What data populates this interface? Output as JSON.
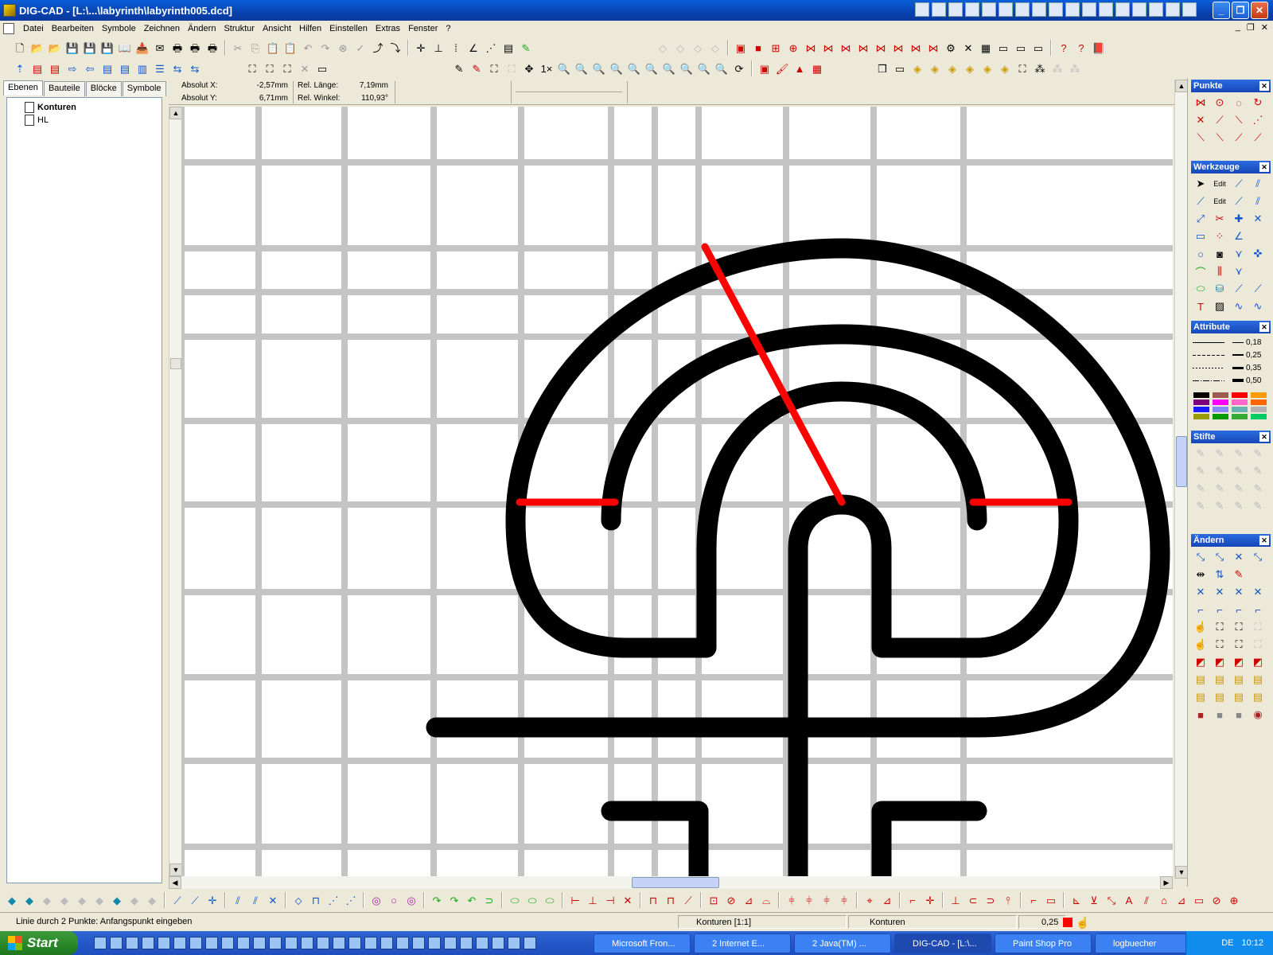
{
  "window": {
    "title": "DIG-CAD - [L:\\...\\labyrinth\\labyrinth005.dcd]"
  },
  "menu": {
    "items": [
      "Datei",
      "Bearbeiten",
      "Symbole",
      "Zeichnen",
      "Ändern",
      "Struktur",
      "Ansicht",
      "Hilfen",
      "Einstellen",
      "Extras",
      "Fenster",
      "?"
    ]
  },
  "left_panel": {
    "tabs": [
      "Ebenen",
      "Bauteile",
      "Blöcke",
      "Symbole"
    ],
    "active_tab": "Ebenen",
    "layers": [
      {
        "name": "Konturen",
        "active": true
      },
      {
        "name": "HL",
        "active": false
      }
    ]
  },
  "coords": {
    "abs_x_label": "Absolut X:",
    "abs_x_value": "-2,57mm",
    "abs_y_label": "Absolut Y:",
    "abs_y_value": "6,71mm",
    "rel_len_label": "Rel. Länge:",
    "rel_len_value": "7,19mm",
    "rel_angle_label": "Rel. Winkel:",
    "rel_angle_value": "110,93°"
  },
  "palettes": {
    "punkte": "Punkte",
    "werkzeuge": "Werkzeuge",
    "attribute": "Attribute",
    "stifte": "Stifte",
    "aendern": "Ändern",
    "line_weights": [
      "0,18",
      "0,25",
      "0,35",
      "0,50"
    ],
    "swatch_colors": [
      "#000000",
      "#9c5a50",
      "#ff0000",
      "#ff9900",
      "#7f007f",
      "#ff00ff",
      "#ff66cc",
      "#ff6600",
      "#1a1aff",
      "#8888ff",
      "#66b2b2",
      "#b2b2b2",
      "#999900",
      "#009900",
      "#33aa33",
      "#00cc66"
    ]
  },
  "canvas": {
    "grid_color": "#c4c4c4",
    "contour_color": "#000000",
    "guide_color": "#ff0000"
  },
  "statusbar": {
    "hint": "Linie durch 2 Punkte: Anfangspunkt eingeben",
    "layer_scale": "Konturen [1:1]",
    "layer": "Konturen",
    "pen": "0,25"
  },
  "taskbar": {
    "start": "Start",
    "tasks": [
      "Microsoft Fron...",
      "2 Internet E...",
      "2 Java(TM) ...",
      "DIG-CAD - [L:\\...",
      "Paint Shop Pro",
      "logbuecher"
    ],
    "active_task": "DIG-CAD - [L:\\...",
    "lang": "DE",
    "clock": "10:12"
  }
}
